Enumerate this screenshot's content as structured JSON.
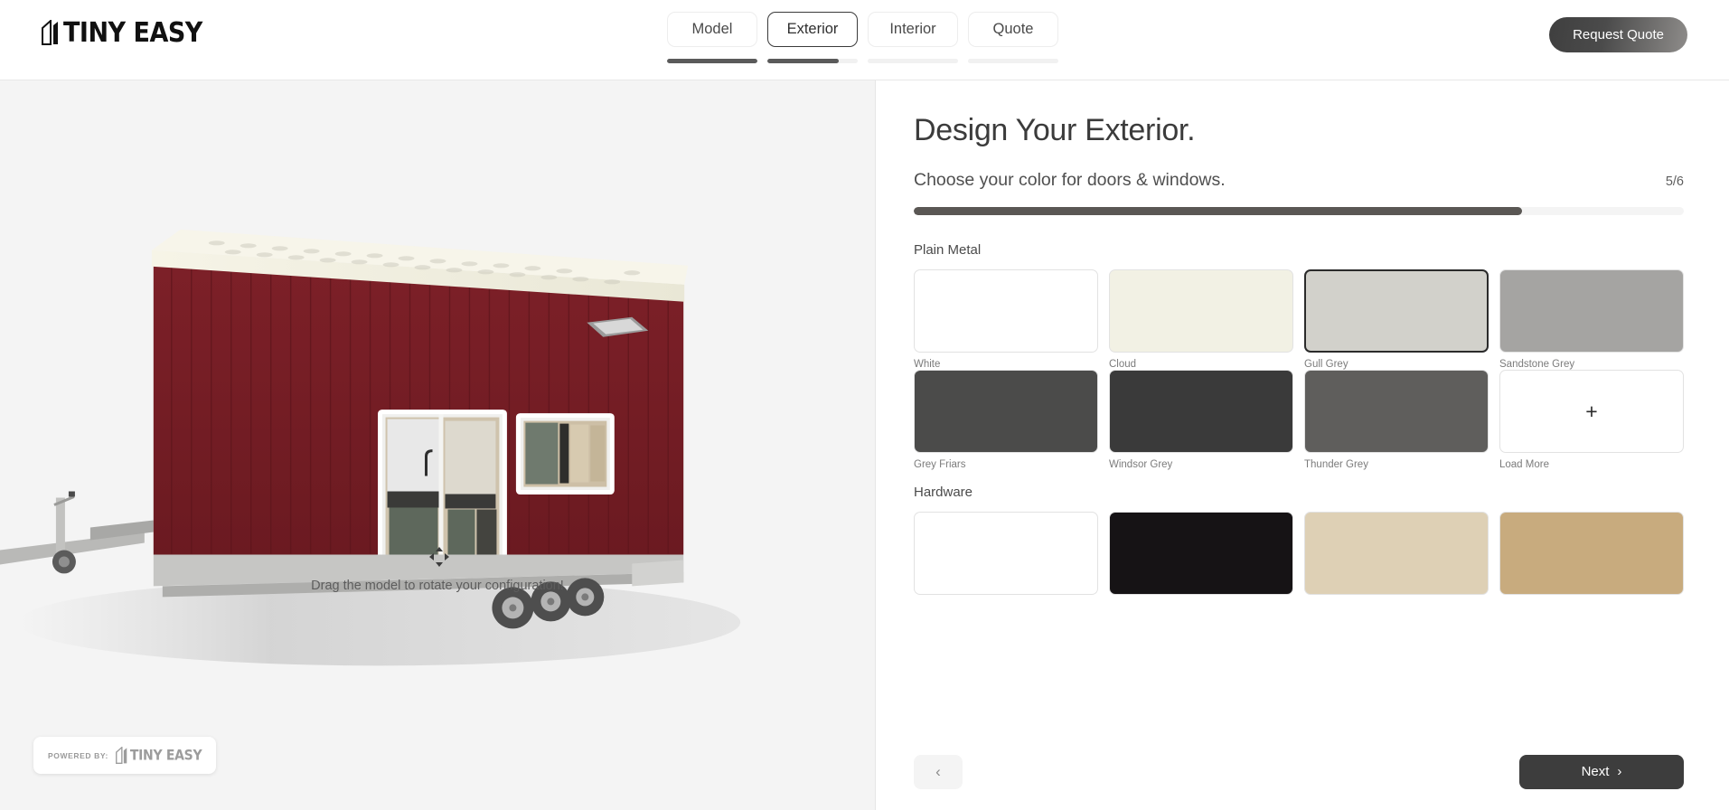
{
  "header": {
    "logo": {
      "word": "TINY EASY",
      "icon": "house-logo-icon"
    },
    "tabs": [
      {
        "label": "Model",
        "progress": 100,
        "active": false
      },
      {
        "label": "Exterior",
        "progress": 79,
        "active": true
      },
      {
        "label": "Interior",
        "progress": 0,
        "active": false
      },
      {
        "label": "Quote",
        "progress": 0,
        "active": false
      }
    ],
    "request_quote_label": "Request Quote"
  },
  "viewer": {
    "drag_hint": "Drag the model to rotate your configuration!",
    "move_icon": "move-arrows-icon",
    "powered_by_label": "POWERED BY:",
    "powered_by_brand": "TINY EASY",
    "model_colors": {
      "cladding": "#7a1f26",
      "roof": "#f2f0e0",
      "trailer": "#b6b6b4",
      "background": "#f4f4f4"
    }
  },
  "panel": {
    "title": "Design Your Exterior.",
    "subtitle": "Choose your color for doors & windows.",
    "step_count": "5/6",
    "progress_percent": 79,
    "groups": [
      {
        "name": "Plain Metal",
        "swatches": [
          {
            "label": "White",
            "color": "#ffffff",
            "selected": false,
            "type": "color"
          },
          {
            "label": "Cloud",
            "color": "#f2f1e4",
            "selected": false,
            "type": "color"
          },
          {
            "label": "Gull Grey",
            "color": "#d2d1cb",
            "selected": true,
            "type": "color"
          },
          {
            "label": "Sandstone Grey",
            "color": "#a5a4a2",
            "selected": false,
            "type": "color"
          },
          {
            "label": "Grey Friars",
            "color": "#4b4b4a",
            "selected": false,
            "type": "color"
          },
          {
            "label": "Windsor Grey",
            "color": "#3a3a3a",
            "selected": false,
            "type": "color"
          },
          {
            "label": "Thunder Grey",
            "color": "#5f5e5c",
            "selected": false,
            "type": "color"
          },
          {
            "label": "Load More",
            "color": "#ffffff",
            "selected": false,
            "type": "load-more",
            "icon": "plus-icon"
          }
        ]
      },
      {
        "name": "Hardware",
        "swatches": [
          {
            "label": "",
            "color": "#ffffff",
            "selected": false,
            "type": "color"
          },
          {
            "label": "",
            "color": "#161315",
            "selected": false,
            "type": "color"
          },
          {
            "label": "",
            "color": "#ded0b5",
            "selected": false,
            "type": "color"
          },
          {
            "label": "",
            "color": "#c8ab7e",
            "selected": false,
            "type": "color"
          }
        ]
      }
    ],
    "footer": {
      "back_label": "‹",
      "next_label": "Next",
      "next_icon": "chevron-right-icon"
    }
  }
}
